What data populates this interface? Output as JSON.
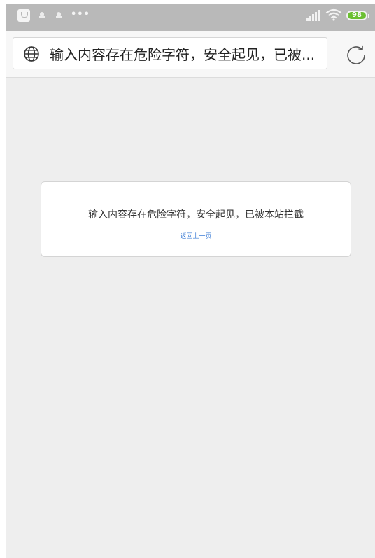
{
  "status_bar": {
    "overflow_dots": "•••",
    "battery_level": "98",
    "battery_color": "#6bbf32",
    "icons": [
      "app-notification-icon",
      "notification-icon",
      "notification-icon",
      "more-icon",
      "signal-icon",
      "wifi-icon",
      "battery-icon"
    ]
  },
  "address_bar": {
    "icon": "globe-icon",
    "url_text": "输入内容存在危险字符，安全起见，已被...",
    "reload_icon": "reload-icon"
  },
  "message_card": {
    "message": "输入内容存在危险字符，安全起见，已被本站拦截",
    "back_link": "返回上一页",
    "link_color": "#3a7bd5"
  }
}
